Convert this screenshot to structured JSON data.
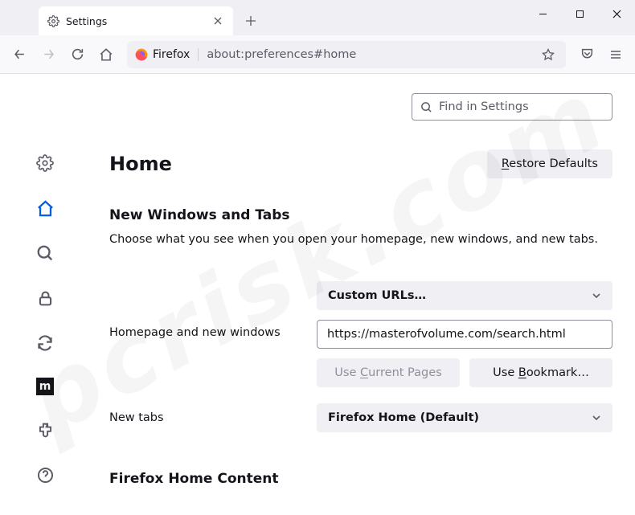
{
  "tab": {
    "title": "Settings"
  },
  "urlbar": {
    "identity": "Firefox",
    "url": "about:preferences#home"
  },
  "search": {
    "placeholder": "Find in Settings"
  },
  "page": {
    "title": "Home",
    "restore_button": "Restore Defaults",
    "section_title": "New Windows and Tabs",
    "section_desc": "Choose what you see when you open your homepage, new windows, and new tabs.",
    "homepage_label": "Homepage and new windows",
    "homepage_select": "Custom URLs…",
    "homepage_url": "https://masterofvolume.com/search.html",
    "use_current": "Use Current Pages",
    "use_bookmark": "Use Bookmark…",
    "newtabs_label": "New tabs",
    "newtabs_select": "Firefox Home (Default)",
    "section2_title": "Firefox Home Content"
  },
  "sidebar_ext_letter": "m",
  "watermark": "pcrisk.com"
}
